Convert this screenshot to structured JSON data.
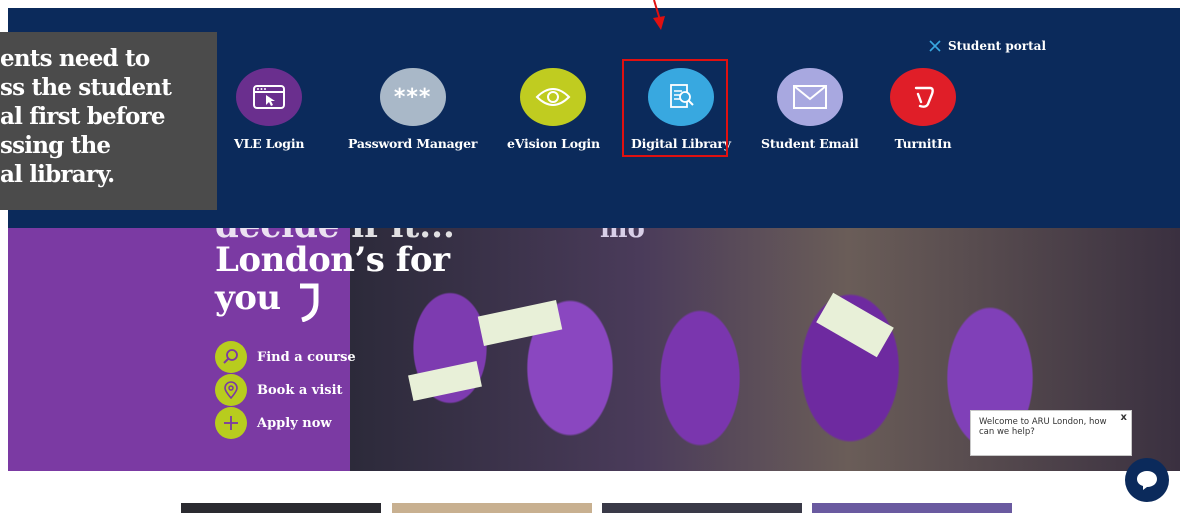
{
  "portal": {
    "close_label": "Student portal",
    "apps": [
      {
        "label": "VLE Login",
        "icon": "browser-cursor-icon",
        "color": "#6a2f8e"
      },
      {
        "label": "Password Manager",
        "icon": "password-asterisks-icon",
        "color": "#a9b8c8"
      },
      {
        "label": "eVision Login",
        "icon": "eye-icon",
        "color": "#c0cc20"
      },
      {
        "label": "Digital Library",
        "icon": "document-search-icon",
        "color": "#38a8e0"
      },
      {
        "label": "Student Email",
        "icon": "envelope-icon",
        "color": "#a8a8e0"
      },
      {
        "label": "TurnitIn",
        "icon": "turnitin-logo-icon",
        "color": "#e01e28"
      }
    ]
  },
  "annotation": {
    "lines": [
      "ents need to",
      "ss the student",
      "al first before",
      "ssing the",
      "al library."
    ]
  },
  "hero": {
    "line_cut": "decide if it...",
    "line1": "London’s for",
    "line2": "you",
    "more_text": "mo",
    "actions": [
      {
        "label": "Find a course",
        "icon": "search-icon"
      },
      {
        "label": "Book a visit",
        "icon": "location-pin-icon"
      },
      {
        "label": "Apply now",
        "icon": "plus-icon"
      }
    ]
  },
  "chat": {
    "message": "Welcome to ARU London, how can we help?",
    "close": "x"
  },
  "colors": {
    "portal_bg": "#0b2a5b",
    "hero_bg": "#7b3aa3",
    "accent_lime": "#b8cc1e",
    "highlight_red": "#e01010"
  }
}
